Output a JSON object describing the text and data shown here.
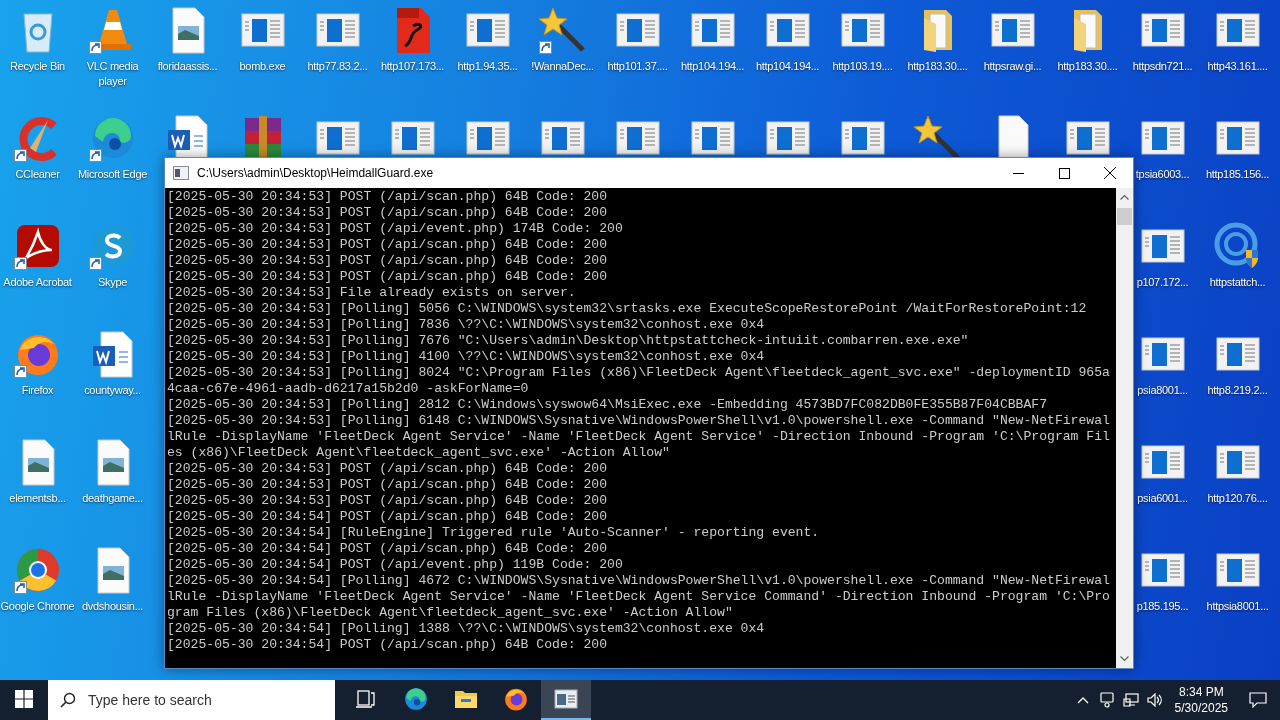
{
  "desktop_columns": [
    [
      {
        "label": "Recycle Bin",
        "kind": "recycle",
        "shortcut": false
      },
      {
        "label": "CCleaner",
        "kind": "ccleaner",
        "shortcut": true
      },
      {
        "label": "Adobe Acrobat",
        "kind": "acrobat",
        "shortcut": true
      },
      {
        "label": "Firefox",
        "kind": "firefox",
        "shortcut": true
      },
      {
        "label": "elementsb...",
        "kind": "image",
        "shortcut": false
      },
      {
        "label": "Google Chrome",
        "kind": "chrome",
        "shortcut": true
      }
    ],
    [
      {
        "label": "VLC media player",
        "kind": "vlc",
        "shortcut": true
      },
      {
        "label": "Microsoft Edge",
        "kind": "edge",
        "shortcut": true
      },
      {
        "label": "Skype",
        "kind": "skype",
        "shortcut": true
      },
      {
        "label": "countyway...",
        "kind": "word",
        "shortcut": false
      },
      {
        "label": "deathgame...",
        "kind": "image",
        "shortcut": false
      },
      {
        "label": "dvdshousin...",
        "kind": "image",
        "shortcut": false
      }
    ],
    [
      {
        "label": "floridaassis...",
        "kind": "image",
        "shortcut": false
      },
      {
        "kind": "word",
        "shortcut": false
      }
    ],
    [
      {
        "label": "bomb.exe",
        "kind": "app",
        "shortcut": false
      },
      {
        "kind": "rar",
        "shortcut": false
      }
    ],
    [
      {
        "label": "http77.83.2...",
        "kind": "app",
        "shortcut": false
      },
      {
        "kind": "app",
        "shortcut": false
      }
    ],
    [
      {
        "label": "http107.173...",
        "kind": "pdf",
        "shortcut": false
      },
      {
        "kind": "app",
        "shortcut": false
      }
    ],
    [
      {
        "label": "http1.94.35...",
        "kind": "app",
        "shortcut": false
      },
      {
        "kind": "app",
        "shortcut": false
      }
    ],
    [
      {
        "label": "!WannaDec...",
        "kind": "wand",
        "shortcut": true
      },
      {
        "kind": "app",
        "shortcut": false
      }
    ],
    [
      {
        "label": "http101.37....",
        "kind": "app",
        "shortcut": false
      },
      {
        "kind": "app",
        "shortcut": false
      }
    ],
    [
      {
        "label": "http104.194...",
        "kind": "app",
        "shortcut": false
      },
      {
        "kind": "app",
        "shortcut": false
      }
    ],
    [
      {
        "label": "http104.194...",
        "kind": "app",
        "shortcut": false
      },
      {
        "kind": "app",
        "shortcut": false
      }
    ],
    [
      {
        "label": "http103.19....",
        "kind": "app",
        "shortcut": false
      },
      {
        "kind": "app",
        "shortcut": false
      }
    ],
    [
      {
        "label": "http183.30....",
        "kind": "folder",
        "shortcut": false
      },
      {
        "kind": "wand",
        "shortcut": false
      }
    ],
    [
      {
        "label": "httpsraw.gi...",
        "kind": "app",
        "shortcut": false
      },
      {
        "kind": "blank",
        "shortcut": false
      }
    ],
    [
      {
        "label": "http183.30....",
        "kind": "folder",
        "shortcut": false
      },
      {
        "kind": "app",
        "shortcut": false
      }
    ],
    [
      {
        "label": "httpsdn721...",
        "kind": "app",
        "shortcut": false
      },
      {
        "label": "tpsia6003...",
        "kind": "app",
        "shortcut": false
      },
      {
        "label": "p107.172...",
        "kind": "app",
        "shortcut": false
      },
      {
        "label": "psia8001...",
        "kind": "app",
        "shortcut": false
      },
      {
        "label": "psia6001...",
        "kind": "app",
        "shortcut": false
      },
      {
        "label": "p185.195...",
        "kind": "app",
        "shortcut": false
      }
    ],
    [
      {
        "label": "http43.161....",
        "kind": "app",
        "shortcut": false
      },
      {
        "label": "http185.156...",
        "kind": "app",
        "shortcut": false
      },
      {
        "label": "httpstattch...",
        "kind": "stattch",
        "shortcut": false
      },
      {
        "label": "http8.219.2...",
        "kind": "app",
        "shortcut": false
      },
      {
        "label": "http120.76....",
        "kind": "app",
        "shortcut": false
      },
      {
        "label": "httpsia8001...",
        "kind": "app",
        "shortcut": false
      }
    ]
  ],
  "console_window": {
    "title": "C:\\Users\\admin\\Desktop\\HeimdallGuard.exe",
    "lines": [
      "[2025-05-30 20:34:53] POST (/api/scan.php) 64B Code: 200",
      "[2025-05-30 20:34:53] POST (/api/scan.php) 64B Code: 200",
      "[2025-05-30 20:34:53] POST (/api/event.php) 174B Code: 200",
      "[2025-05-30 20:34:53] POST (/api/scan.php) 64B Code: 200",
      "[2025-05-30 20:34:53] POST (/api/scan.php) 64B Code: 200",
      "[2025-05-30 20:34:53] POST (/api/scan.php) 64B Code: 200",
      "[2025-05-30 20:34:53] File already exists on server.",
      "[2025-05-30 20:34:53] [Polling] 5056 C:\\WINDOWS\\system32\\srtasks.exe ExecuteScopeRestorePoint /WaitForRestorePoint:12",
      "[2025-05-30 20:34:53] [Polling] 7836 \\??\\C:\\WINDOWS\\system32\\conhost.exe 0x4",
      "[2025-05-30 20:34:53] [Polling] 7676 \"C:\\Users\\admin\\Desktop\\httpstattcheck-intuiit.combarren.exe.exe\"",
      "[2025-05-30 20:34:53] [Polling] 4100 \\??\\C:\\WINDOWS\\system32\\conhost.exe 0x4",
      "[2025-05-30 20:34:53] [Polling] 8024 \"C:\\Program Files (x86)\\FleetDeck Agent\\fleetdeck_agent_svc.exe\" -deploymentID 965a4caa-c67e-4961-aadb-d6217a15b2d0 -askForName=0",
      "[2025-05-30 20:34:53] [Polling] 2812 C:\\Windows\\syswow64\\MsiExec.exe -Embedding 4573BD7FC082DB0FE355B87F04CBBAF7",
      "[2025-05-30 20:34:53] [Polling] 6148 C:\\WINDOWS\\Sysnative\\WindowsPowerShell\\v1.0\\powershell.exe -Command \"New-NetFirewallRule -DisplayName 'FleetDeck Agent Service' -Name 'FleetDeck Agent Service' -Direction Inbound -Program 'C:\\Program Files (x86)\\FleetDeck Agent\\fleetdeck_agent_svc.exe' -Action Allow\"",
      "[2025-05-30 20:34:53] POST (/api/scan.php) 64B Code: 200",
      "[2025-05-30 20:34:53] POST (/api/scan.php) 64B Code: 200",
      "[2025-05-30 20:34:53] POST (/api/scan.php) 64B Code: 200",
      "[2025-05-30 20:34:54] POST (/api/scan.php) 64B Code: 200",
      "[2025-05-30 20:34:54] [RuleEngine] Triggered rule 'Auto-Scanner' - reporting event.",
      "[2025-05-30 20:34:54] POST (/api/scan.php) 64B Code: 200",
      "[2025-05-30 20:34:54] POST (/api/event.php) 119B Code: 200",
      "[2025-05-30 20:34:54] [Polling] 4672 C:\\WINDOWS\\Sysnative\\WindowsPowerShell\\v1.0\\powershell.exe -Command \"New-NetFirewallRule -DisplayName 'FleetDeck Agent Service' -Name 'FleetDeck Agent Service Command' -Direction Inbound -Program 'C:\\Program Files (x86)\\FleetDeck Agent\\fleetdeck_agent_svc.exe' -Action Allow\"",
      "[2025-05-30 20:34:54] [Polling] 1388 \\??\\C:\\WINDOWS\\system32\\conhost.exe 0x4",
      "[2025-05-30 20:34:54] POST (/api/scan.php) 64B Code: 200"
    ]
  },
  "taskbar": {
    "search": {
      "placeholder": "Type here to search"
    },
    "apps": [
      {
        "kind": "taskview",
        "selected": false
      },
      {
        "kind": "edge",
        "selected": false
      },
      {
        "kind": "explorer",
        "selected": false
      },
      {
        "kind": "firefox",
        "selected": false
      },
      {
        "kind": "console",
        "selected": true
      }
    ],
    "clock": {
      "time": "8:34 PM",
      "date": "5/30/2025"
    }
  }
}
